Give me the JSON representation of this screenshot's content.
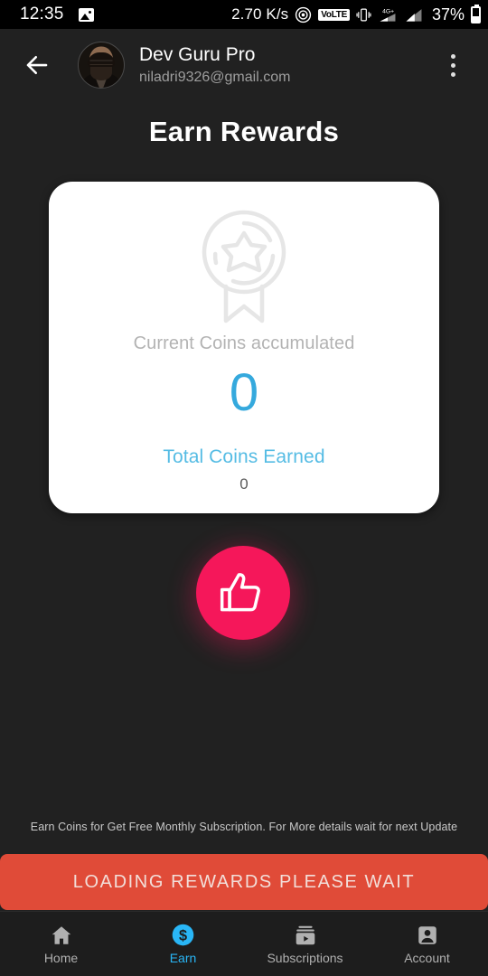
{
  "statusbar": {
    "time": "12:35",
    "left_icon": "image-notification-icon",
    "network_speed": "2.70 K/s",
    "hotspot_icon": "hotspot-icon",
    "volte_label": "VoLTE",
    "vibrate_icon": "vibrate-icon",
    "signal1_label": "4G+",
    "signal2_icon": "signal-bars-icon",
    "battery_percent": "37%",
    "battery_icon": "battery-icon"
  },
  "header": {
    "back_icon": "back-arrow-icon",
    "avatar": "user-avatar",
    "name": "Dev Guru Pro",
    "email": "niladri9326@gmail.com",
    "menu_icon": "overflow-menu-icon"
  },
  "page": {
    "title": "Earn Rewards"
  },
  "card": {
    "badge_icon": "award-badge-icon",
    "current_label": "Current Coins accumulated",
    "current_value": "0",
    "total_label": "Total Coins Earned",
    "total_value": "0"
  },
  "fab": {
    "icon": "thumbs-up-icon",
    "color": "#F5175A"
  },
  "footnote": {
    "text": "Earn Coins for Get Free Monthly Subscription. For More details wait for next Update"
  },
  "loading_banner": {
    "text": "LOADING REWARDS PLEASE WAIT",
    "color": "#E04B38"
  },
  "bottomnav": {
    "active_color": "#29B6F6",
    "items": [
      {
        "label": "Home",
        "icon": "home-icon",
        "active": false
      },
      {
        "label": "Earn",
        "icon": "dollar-coin-icon",
        "active": true
      },
      {
        "label": "Subscriptions",
        "icon": "subscriptions-icon",
        "active": false
      },
      {
        "label": "Account",
        "icon": "account-person-icon",
        "active": false
      }
    ]
  },
  "colors": {
    "background": "#212121",
    "card": "#ffffff",
    "accent_blue": "#35a9dd",
    "accent_pink": "#F5175A",
    "banner_red": "#E04B38"
  }
}
